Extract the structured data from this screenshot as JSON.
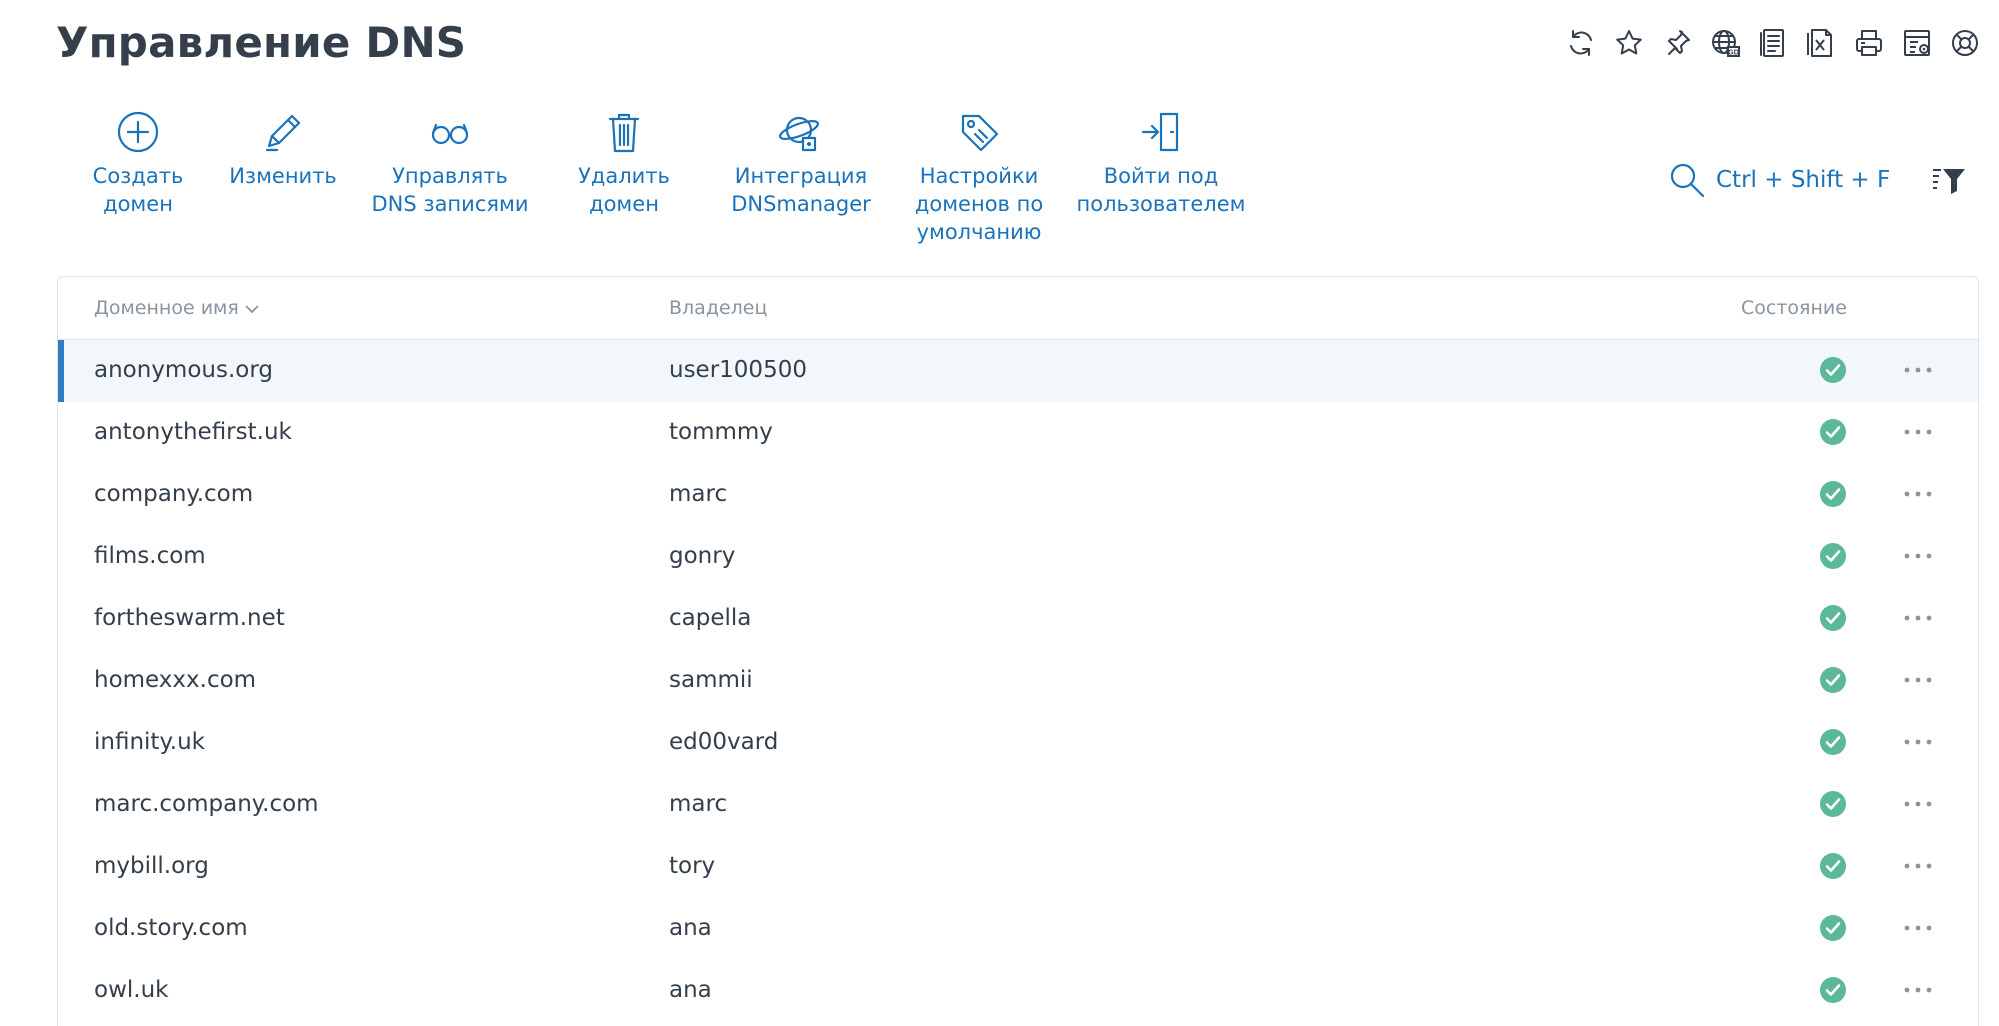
{
  "page": {
    "title": "Управление DNS"
  },
  "top_icons": [
    {
      "name": "refresh-icon"
    },
    {
      "name": "star-icon"
    },
    {
      "name": "pin-icon"
    },
    {
      "name": "globe-icon"
    },
    {
      "name": "list-icon"
    },
    {
      "name": "excel-export-icon"
    },
    {
      "name": "print-icon"
    },
    {
      "name": "table-settings-icon"
    },
    {
      "name": "help-lifebuoy-icon"
    }
  ],
  "toolbar": {
    "create": "Создать\nдомен",
    "edit": "Изменить",
    "manage_records": "Управлять\nDNS записями",
    "delete": "Удалить\nдомен",
    "integration": "Интеграция\nDNSmanager",
    "defaults": "Настройки\nдоменов по\nумолчанию",
    "login_as": "Войти под\nпользователем"
  },
  "search": {
    "shortcut": "Ctrl + Shift + F"
  },
  "table": {
    "headers": {
      "name": "Доменное имя",
      "owner": "Владелец",
      "state": "Состояние"
    },
    "rows": [
      {
        "name": "anonymous.org",
        "owner": "user100500",
        "state": "ok"
      },
      {
        "name": "antonythefirst.uk",
        "owner": "tommmy",
        "state": "ok"
      },
      {
        "name": "company.com",
        "owner": "marc",
        "state": "ok"
      },
      {
        "name": "films.com",
        "owner": "gonry",
        "state": "ok"
      },
      {
        "name": "fortheswarm.net",
        "owner": "capella",
        "state": "ok"
      },
      {
        "name": "homexxx.com",
        "owner": "sammii",
        "state": "ok"
      },
      {
        "name": "infinity.uk",
        "owner": "ed00vard",
        "state": "ok"
      },
      {
        "name": "marc.company.com",
        "owner": "marc",
        "state": "ok"
      },
      {
        "name": "mybill.org",
        "owner": "tory",
        "state": "ok"
      },
      {
        "name": "old.story.com",
        "owner": "ana",
        "state": "ok"
      },
      {
        "name": "owl.uk",
        "owner": "ana",
        "state": "ok"
      }
    ]
  },
  "colors": {
    "accent": "#1a73ba",
    "text": "#343f4b",
    "muted": "#8a949e",
    "success": "#5cb89a",
    "selected_bg": "#f2f7fb",
    "selected_bar": "#2f7dc1"
  }
}
